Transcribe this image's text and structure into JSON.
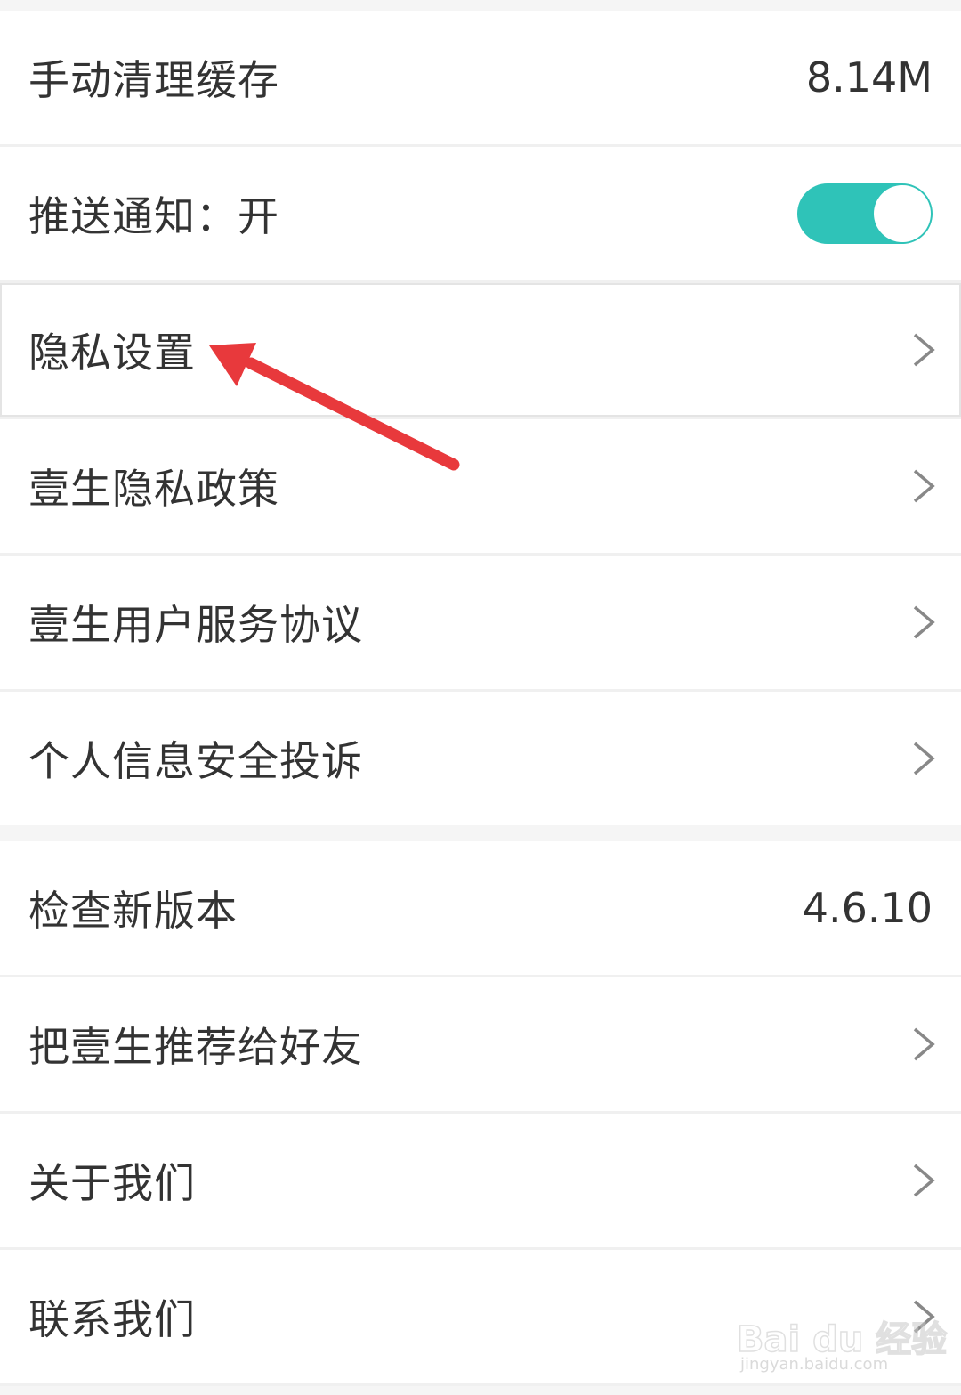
{
  "settings_group_1": [
    {
      "label": "手动清理缓存",
      "value": "8.14M",
      "kind": "value"
    },
    {
      "label": "推送通知：开",
      "toggle_on": true,
      "kind": "toggle"
    },
    {
      "label": "隐私设置",
      "kind": "chevron",
      "highlighted": true
    },
    {
      "label": "壹生隐私政策",
      "kind": "chevron"
    },
    {
      "label": "壹生用户服务协议",
      "kind": "chevron"
    },
    {
      "label": "个人信息安全投诉",
      "kind": "chevron"
    }
  ],
  "settings_group_2": [
    {
      "label": "检查新版本",
      "value": "4.6.10",
      "kind": "value"
    },
    {
      "label": "把壹生推荐给好友",
      "kind": "chevron"
    },
    {
      "label": "关于我们",
      "kind": "chevron"
    },
    {
      "label": "联系我们",
      "kind": "chevron"
    }
  ],
  "icons": {
    "chevron": "chevron-right-icon",
    "annotation": "red-arrow-annotation"
  },
  "colors": {
    "toggle_on": "#2fc3b8",
    "annotation_arrow": "#e8393c",
    "text": "#333333",
    "divider": "#f0f0f0"
  },
  "watermark": {
    "brand": "Bai du 经验",
    "url": "jingyan.baidu.com"
  }
}
